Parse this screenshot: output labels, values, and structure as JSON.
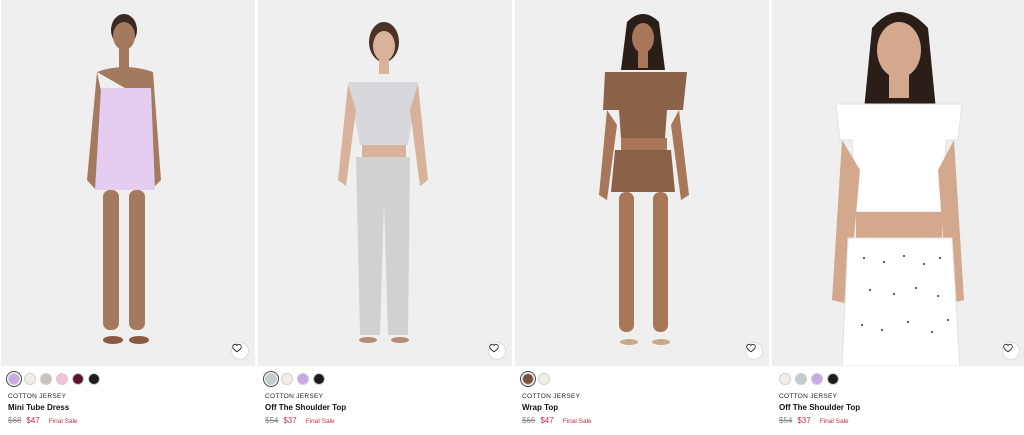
{
  "products": [
    {
      "category": "COTTON JERSEY",
      "name": "Mini Tube Dress",
      "original_price": "$68",
      "sale_price": "$47",
      "badge": "Final Sale",
      "swatches": [
        "#c9a8e6",
        "#f1efe8",
        "#c7c3bc",
        "#f2c2da",
        "#5a1530",
        "#1c1c1c"
      ],
      "selected_swatch": 0,
      "garment_color": "#e4cdf0"
    },
    {
      "category": "COTTON JERSEY",
      "name": "Off The Shoulder Top",
      "original_price": "$54",
      "sale_price": "$37",
      "badge": "Final Sale",
      "swatches": [
        "#c5ccce",
        "#f1efe8",
        "#c9a8e6",
        "#1c1c1c"
      ],
      "selected_swatch": 0,
      "garment_color": "#d6d8db"
    },
    {
      "category": "COTTON JERSEY",
      "name": "Wrap Top",
      "original_price": "$66",
      "sale_price": "$47",
      "badge": "Final Sale",
      "swatches": [
        "#7a5238",
        "#f1efe8"
      ],
      "selected_swatch": 0,
      "garment_color": "#8b6248"
    },
    {
      "category": "COTTON JERSEY",
      "name": "Off The Shoulder Top",
      "original_price": "$54",
      "sale_price": "$37",
      "badge": "Final Sale",
      "swatches": [
        "#f1efe8",
        "#c5ccce",
        "#c9a8e6",
        "#1c1c1c"
      ],
      "selected_swatch": -1,
      "garment_color": "#ffffff"
    }
  ],
  "icons": {
    "wishlist": "heart-icon"
  },
  "colors": {
    "sale": "#c2304b",
    "strike": "#8a8a8a",
    "photo_bg": "#efefef"
  }
}
